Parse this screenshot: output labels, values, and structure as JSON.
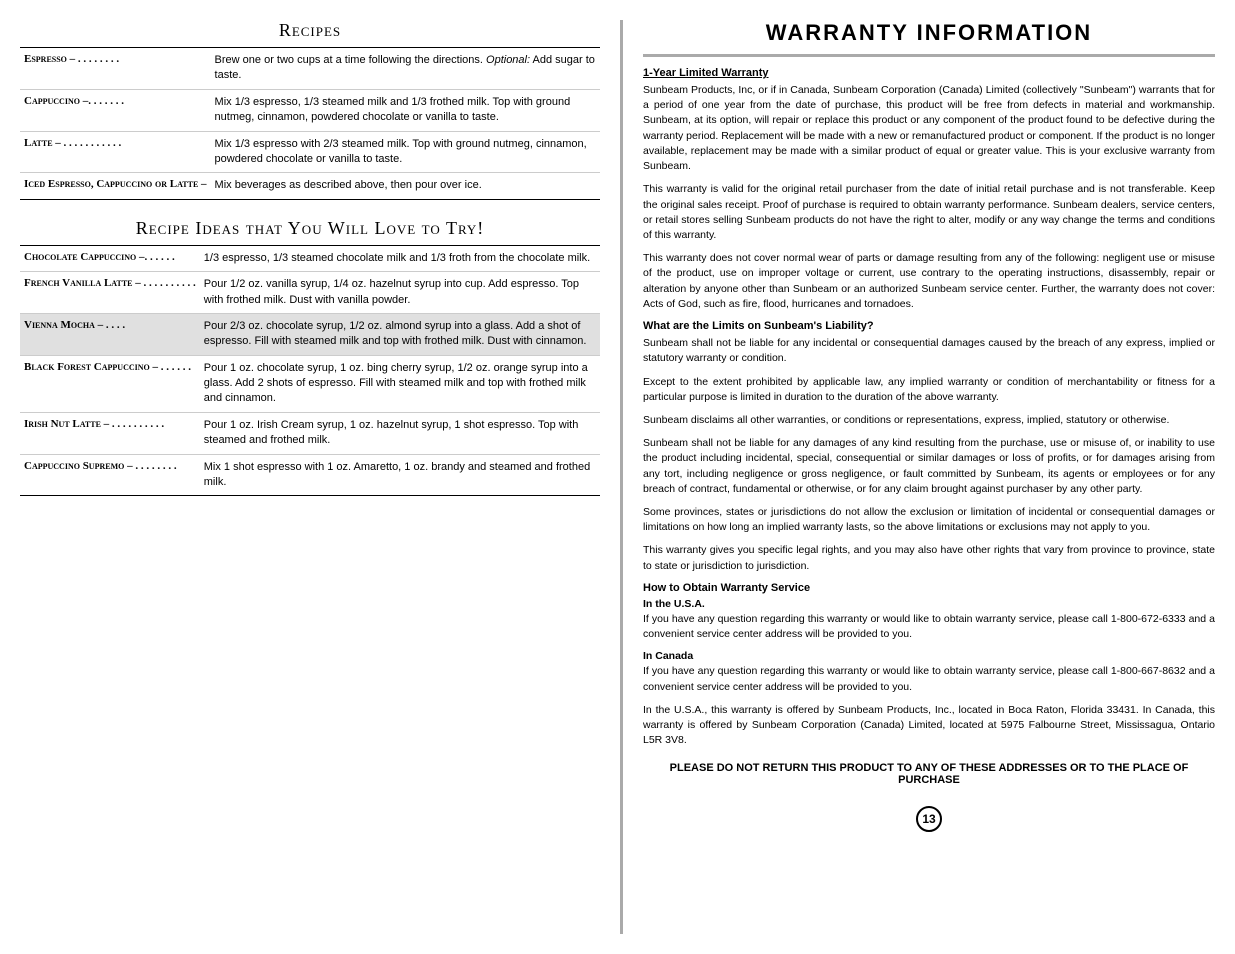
{
  "left": {
    "recipes_title": "Recipes",
    "recipes": [
      {
        "name": "Espresso –  . . . . . . . .",
        "description": "Brew one or two cups at a time following the directions. Optional: Add sugar to taste."
      },
      {
        "name": "Cappuccino –. . . . . . .",
        "description": "Mix 1/3 espresso, 1/3 steamed milk and 1/3 frothed milk. Top with ground nutmeg, cinnamon, powdered chocolate or vanilla to taste."
      },
      {
        "name": "Latte –  . . . . . . . . . . .",
        "description": "Mix 1/3 espresso with 2/3 steamed milk. Top with ground nutmeg, cinnamon, powdered chocolate or vanilla to taste."
      },
      {
        "name": "Iced Espresso, Cappuccino or Latte –",
        "description": "Mix beverages as described above, then pour over ice."
      }
    ],
    "ideas_title": "Recipe Ideas that You Will Love to Try!",
    "ideas": [
      {
        "name": "Chocolate Cappuccino –. . . . . .",
        "description": "1/3 espresso, 1/3 steamed chocolate milk and 1/3 froth from the chocolate milk.",
        "highlight": false
      },
      {
        "name": "French Vanilla Latte –  . . . . . . . . . .",
        "description": "Pour 1/2 oz. vanilla syrup, 1/4 oz. hazelnut syrup into cup. Add espresso. Top with frothed milk. Dust with vanilla powder.",
        "highlight": false
      },
      {
        "name": "Vienna Mocha –  . . . .",
        "description": "Pour 2/3 oz. chocolate syrup, 1/2 oz. almond syrup into a glass. Add a shot of espresso. Fill with steamed milk and top with frothed milk. Dust with cinnamon.",
        "highlight": true
      },
      {
        "name": "Black Forest Cappuccino  –  . . . . . .",
        "description": "Pour 1 oz. chocolate syrup, 1 oz. bing cherry syrup, 1/2 oz. orange syrup into a glass. Add 2 shots of espresso. Fill with steamed milk and top with frothed milk and cinnamon.",
        "highlight": false
      },
      {
        "name": "Irish Nut Latte –  . . . . . . . . . .",
        "description": "Pour 1 oz. Irish Cream syrup, 1 oz. hazelnut syrup, 1 shot espresso. Top with steamed and frothed milk.",
        "highlight": false
      },
      {
        "name": "Cappuccino Supremo –  . . . . . . . .",
        "description": "Mix 1 shot espresso with 1 oz. Amaretto, 1 oz. brandy and steamed and frothed milk.",
        "highlight": false
      }
    ]
  },
  "right": {
    "warranty_title": "Warranty Information",
    "one_year_title": "1-Year Limited Warranty",
    "warranty_para1": "Sunbeam Products, Inc, or if in Canada, Sunbeam Corporation (Canada) Limited (collectively \"Sunbeam\") warrants that for a period of one year from the date of purchase, this product will be free from defects in material and workmanship.  Sunbeam, at its option, will repair or replace this product or any component of the product found to be defective during the warranty period.  Replacement will be made with a new or remanufactured product or component.  If the product is no longer available, replacement may be made with a similar product of equal or greater value.  This is your exclusive warranty from Sunbeam.",
    "warranty_para2": "This warranty is valid for the original retail purchaser from the date of initial retail purchase and is not transferable.  Keep the original sales receipt.  Proof of purchase is required to obtain warranty performance. Sunbeam dealers, service centers, or retail stores selling Sunbeam products do not have the right to alter, modify or any way change the terms and conditions of this warranty.",
    "warranty_para3": "This warranty does not cover normal wear of parts or damage resulting from any of the following: negligent use or misuse of the product, use on improper voltage or current, use contrary to the operating instructions, disassembly, repair or alteration by anyone other than Sunbeam or an authorized Sunbeam service center. Further, the warranty does not cover: Acts of God, such as fire, flood, hurricanes and tornadoes.",
    "limits_title": "What are the Limits on Sunbeam's Liability?",
    "limits_para1": "Sunbeam shall not be liable for any incidental or consequential damages caused by the breach of any express, implied or statutory warranty or condition.",
    "limits_para2": "Except to the extent prohibited by applicable law, any implied warranty or condition of merchantability or fitness for a particular purpose is limited in duration to the duration of the above warranty.",
    "limits_para3": "Sunbeam disclaims all other warranties, or conditions or representations, express, implied, statutory or otherwise.",
    "limits_para4": "Sunbeam shall not be liable for any damages of any kind resulting from the purchase, use or misuse of, or inability to use the product including incidental, special, consequential or similar damages or loss of profits, or for damages arising from any tort, including negligence or gross negligence, or fault committed by Sunbeam, its agents or employees or for any breach of contract, fundamental or otherwise, or for any claim brought against purchaser by any other party.",
    "limits_para5": "Some provinces, states or jurisdictions do not allow the exclusion or limitation of incidental or consequential damages or limitations on how long an implied warranty lasts, so the above limitations or exclusions may not apply to you.",
    "limits_para6": "This warranty gives you specific legal rights, and you may also have other rights that vary from province to province, state to state or jurisdiction to jurisdiction.",
    "how_title": "How to Obtain Warranty Service",
    "usa_title": "In the U.S.A.",
    "usa_text": "If you have any question regarding this warranty or would like to obtain warranty service, please call 1-800-672-6333 and a convenient service center address will be provided to you.",
    "canada_title": "In Canada",
    "canada_text": "If you have any question regarding this warranty or would like to obtain warranty service, please call 1-800-667-8632 and a convenient service center address will be provided to you.",
    "location_text": "In the U.S.A., this warranty is offered by Sunbeam Products, Inc., located in Boca Raton, Florida 33431. In Canada, this warranty is offered by Sunbeam Corporation (Canada) Limited, located at 5975 Falbourne Street, Mississagua, Ontario L5R 3V8.",
    "footer_text": "Please do not return this product to any of these addresses or to the place of purchase",
    "page_number": "13"
  }
}
